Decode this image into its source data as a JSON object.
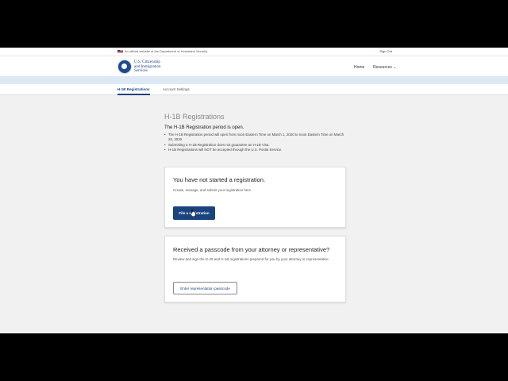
{
  "banner": {
    "official_text": "An official website of the Department of Homeland Security",
    "sign_out": "Sign Out"
  },
  "header": {
    "agency_line1": "U.S. Citizenship",
    "agency_line2": "and Immigration",
    "agency_line3": "Services",
    "nav_home": "Home",
    "nav_resources": "Resources ⌄"
  },
  "tabs": [
    {
      "label": "H-1B Registrations",
      "active": true
    },
    {
      "label": "Account Settings",
      "active": false
    }
  ],
  "main": {
    "title": "H-1B Registrations",
    "period_heading": "The H-1B Registration period is open.",
    "bullets": [
      "The H-1B Registration period will open from noon Eastern Time on March 1, 2020 to noon Eastern Time on March 20, 2020.",
      "Submitting a H-1B Registration does not guarantee an H-1B Visa.",
      "H-1B Registrations will NOT be accepted through the U.S. Postal Service."
    ]
  },
  "card_start": {
    "heading": "You have not started a registration.",
    "description": "Create, manage, and submit your registration here.",
    "button": "File a registration"
  },
  "card_passcode": {
    "heading": "Received a passcode from your attorney or representative?",
    "description": "Review and sign the G-28 and H-1B registrations prepared for you by your attorney or representative.",
    "button": "Enter representation passcode"
  },
  "colors": {
    "primary": "#1a4480",
    "background": "#f1f1f1",
    "strip": "#dde8f5"
  }
}
